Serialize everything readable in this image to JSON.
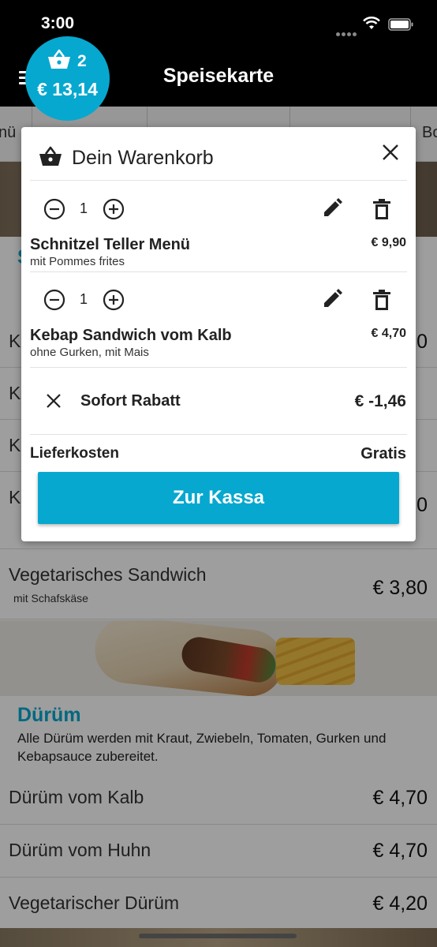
{
  "status_bar": {
    "time": "3:00"
  },
  "header": {
    "title": "Speisekarte"
  },
  "cart_badge": {
    "count": "2",
    "total": "€ 13,14"
  },
  "category_tabs": [
    "nü",
    "Bo"
  ],
  "section_background": {
    "title_initial": "S"
  },
  "menu_items": [
    {
      "name": "K",
      "price": "0"
    },
    {
      "name": "K",
      "price": ""
    },
    {
      "name": "K",
      "price": ""
    },
    {
      "name": "K",
      "price": "0"
    },
    {
      "name": "Vegetarisches Sandwich",
      "subtitle": "mit Schafskäse",
      "price": "€ 3,80"
    }
  ],
  "durum": {
    "title": "Dürüm",
    "description": "Alle Dürüm werden mit Kraut, Zwiebeln, Tomaten, Gurken und Kebapsauce zubereitet.",
    "items": [
      {
        "name": "Dürüm vom Kalb",
        "price": "€ 4,70"
      },
      {
        "name": "Dürüm vom Huhn",
        "price": "€ 4,70"
      },
      {
        "name": "Vegetarischer Dürüm",
        "price": "€ 4,20"
      }
    ]
  },
  "cart": {
    "title": "Dein Warenkorb",
    "items": [
      {
        "quantity": "1",
        "name": "Schnitzel Teller Menü",
        "subtitle": "mit Pommes frites",
        "price": "€ 9,90"
      },
      {
        "quantity": "1",
        "name": "Kebap Sandwich vom Kalb",
        "subtitle": "ohne Gurken, mit Mais",
        "price": "€ 4,70"
      }
    ],
    "discount": {
      "label": "Sofort Rabatt",
      "value": "€ -1,46"
    },
    "delivery": {
      "label": "Lieferkosten",
      "value": "Gratis"
    },
    "checkout_label": "Zur Kassa"
  },
  "colors": {
    "accent": "#06a8cf",
    "header": "#000000"
  },
  "icons": [
    "basket-icon",
    "close-icon",
    "minus-circle-icon",
    "plus-circle-icon",
    "pencil-icon",
    "trash-icon",
    "menu-icon",
    "wifi-icon",
    "battery-icon"
  ]
}
